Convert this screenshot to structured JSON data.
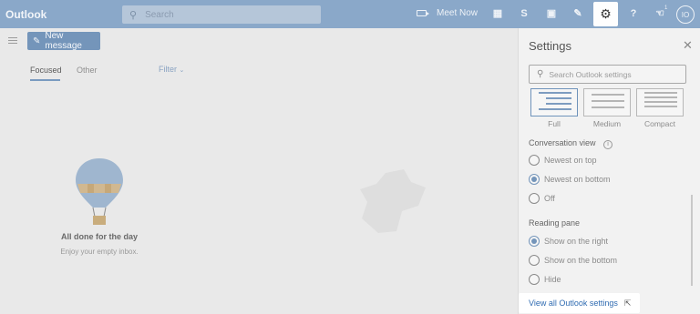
{
  "app": {
    "title": "Outlook"
  },
  "topbar": {
    "search_placeholder": "Search",
    "meet_now_label": "Meet Now",
    "avatar_initials": "IO",
    "badge_count": "1"
  },
  "toolbar": {
    "new_message_label": "New message"
  },
  "tabs": {
    "focused": "Focused",
    "other": "Other",
    "filter": "Filter"
  },
  "empty_state": {
    "title": "All done for the day",
    "subtitle": "Enjoy your empty inbox."
  },
  "settings": {
    "title": "Settings",
    "search_placeholder": "Search Outlook settings",
    "density_options": [
      "Full",
      "Medium",
      "Compact"
    ],
    "density_selected": "Full",
    "conversation_view": {
      "heading": "Conversation view",
      "options": [
        "Newest on top",
        "Newest on bottom",
        "Off"
      ],
      "selected": "Newest on bottom"
    },
    "reading_pane": {
      "heading": "Reading pane",
      "options": [
        "Show on the right",
        "Show on the bottom",
        "Hide"
      ],
      "selected": "Show on the right"
    },
    "view_all_label": "View all Outlook settings"
  },
  "colors": {
    "accent": "#7495ba",
    "topbar": "#8aa8c9",
    "link": "#2f6bb1"
  }
}
